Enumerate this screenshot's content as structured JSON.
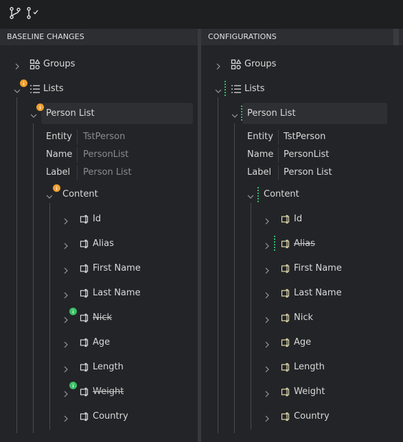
{
  "toolbar": {
    "icons": [
      "branch-icon",
      "branch-check-icon"
    ]
  },
  "left": {
    "header": "BASELINE CHANGES",
    "groups": "Groups",
    "lists": "Lists",
    "person_list": "Person List",
    "props": [
      {
        "key": "Entity",
        "value": "TstPerson"
      },
      {
        "key": "Name",
        "value": "PersonList"
      },
      {
        "key": "Label",
        "value": "Person List"
      }
    ],
    "content": "Content",
    "fields": [
      "Id",
      "Alias",
      "First Name",
      "Last Name",
      "Nick",
      "Age",
      "Length",
      "Weight",
      "Country"
    ]
  },
  "right": {
    "header": "CONFIGURATIONS",
    "groups": "Groups",
    "lists": "Lists",
    "person_list": "Person List",
    "props": [
      {
        "key": "Entity",
        "value": "TstPerson"
      },
      {
        "key": "Name",
        "value": "PersonList"
      },
      {
        "key": "Label",
        "value": "Person List"
      }
    ],
    "content": "Content",
    "fields": [
      "Id",
      "Alias",
      "First Name",
      "Last Name",
      "Nick",
      "Age",
      "Length",
      "Weight",
      "Country"
    ]
  },
  "colors": {
    "badge_orange": "#f0a030",
    "badge_green": "#3cbf6a",
    "dotted_marker": "#2fbf6f"
  }
}
